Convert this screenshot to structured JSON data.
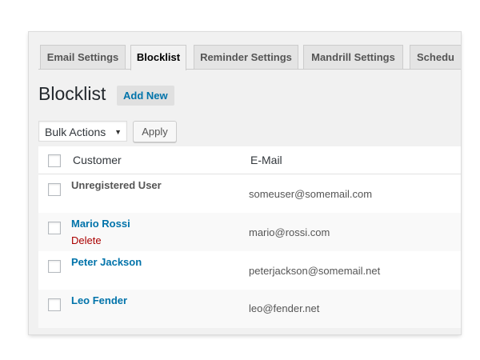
{
  "tabs": [
    {
      "label": "Email Settings",
      "active": false
    },
    {
      "label": "Blocklist",
      "active": true
    },
    {
      "label": "Reminder Settings",
      "active": false
    },
    {
      "label": "Mandrill Settings",
      "active": false
    },
    {
      "label": "Schedu",
      "active": false
    }
  ],
  "page": {
    "title": "Blocklist",
    "add_new_label": "Add New"
  },
  "bulk_actions": {
    "selected": "Bulk Actions",
    "apply_label": "Apply"
  },
  "table": {
    "columns": [
      "Customer",
      "E-Mail"
    ],
    "rows": [
      {
        "customer": "Unregistered User",
        "email": "someuser@somemail.com",
        "linked": false,
        "row_action": ""
      },
      {
        "customer": "Mario Rossi",
        "email": "mario@rossi.com",
        "linked": true,
        "row_action": "Delete"
      },
      {
        "customer": "Peter Jackson",
        "email": "peterjackson@somemail.net",
        "linked": true,
        "row_action": ""
      },
      {
        "customer": "Leo Fender",
        "email": "leo@fender.net",
        "linked": true,
        "row_action": ""
      }
    ]
  },
  "colors": {
    "link": "#0073aa",
    "delete": "#aa0000",
    "panel_bg": "#f1f1f1"
  }
}
